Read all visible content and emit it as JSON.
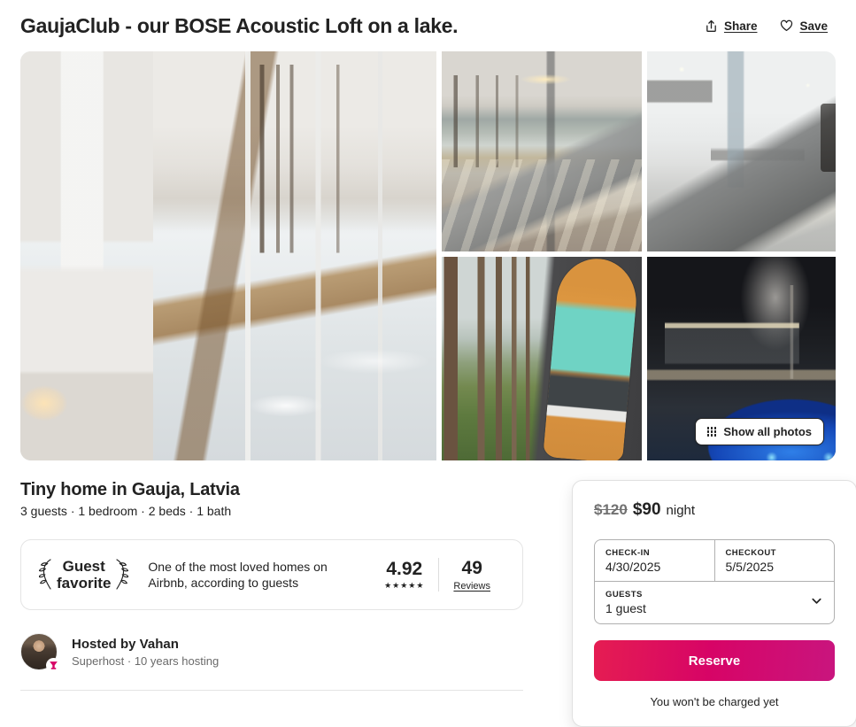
{
  "header": {
    "title": "GaujaClub - our BOSE Acoustic Loft on a lake.",
    "share_label": "Share",
    "save_label": "Save"
  },
  "gallery": {
    "show_all_label": "Show all photos",
    "photos": [
      {
        "alt": "Interior with glass wall overlooking snowy lake"
      },
      {
        "alt": "Bedroom with floor-to-ceiling windows and lake view"
      },
      {
        "alt": "White bedroom with kitchenette"
      },
      {
        "alt": "Paddleboard leaning against cabin in pine forest"
      },
      {
        "alt": "Outdoor sauna and steaming hot tub at night"
      }
    ]
  },
  "listing": {
    "title": "Tiny home in Gauja, Latvia",
    "meta": "3 guests · 1 bedroom · 2 beds · 1 bath"
  },
  "guest_favorite": {
    "badge_label": "Guest\nfavorite",
    "description": "One of the most loved homes on Airbnb, according to guests",
    "rating": "4.92",
    "stars": "★★★★★",
    "reviews_count": "49",
    "reviews_label": "Reviews"
  },
  "host": {
    "name": "Hosted by Vahan",
    "details": "Superhost · 10 years hosting"
  },
  "booking": {
    "price_original": "$120",
    "price_current": "$90",
    "price_unit": "night",
    "checkin_label": "CHECK-IN",
    "checkin_value": "4/30/2025",
    "checkout_label": "CHECKOUT",
    "checkout_value": "5/5/2025",
    "guests_label": "GUESTS",
    "guests_value": "1 guest",
    "reserve_label": "Reserve",
    "disclaimer": "You won't be charged yet"
  },
  "colors": {
    "brand_pink": "#d70466",
    "brand_crimson": "#e51d52",
    "text_primary": "#222222",
    "text_muted": "#717171"
  }
}
